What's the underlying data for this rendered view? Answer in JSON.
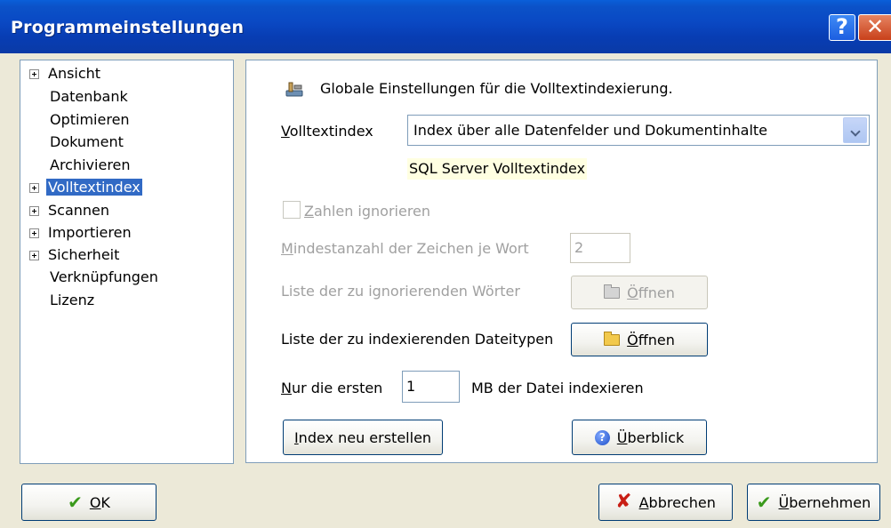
{
  "window": {
    "title": "Programmeinstellungen",
    "help_icon": "help-icon",
    "close_icon": "close-icon"
  },
  "tree": {
    "items": [
      {
        "label": "Ansicht",
        "expandable": true,
        "selected": false
      },
      {
        "label": "Datenbank",
        "expandable": false,
        "selected": false
      },
      {
        "label": "Optimieren",
        "expandable": false,
        "selected": false
      },
      {
        "label": "Dokument",
        "expandable": false,
        "selected": false
      },
      {
        "label": "Archivieren",
        "expandable": false,
        "selected": false
      },
      {
        "label": "Volltextindex",
        "expandable": true,
        "selected": true
      },
      {
        "label": "Scannen",
        "expandable": true,
        "selected": false
      },
      {
        "label": "Importieren",
        "expandable": true,
        "selected": false
      },
      {
        "label": "Sicherheit",
        "expandable": true,
        "selected": false
      },
      {
        "label": "Verknüpfungen",
        "expandable": false,
        "selected": false
      },
      {
        "label": "Lizenz",
        "expandable": false,
        "selected": false
      }
    ]
  },
  "panel": {
    "header": "Globale Einstellungen für die Volltextindexierung.",
    "fulltext_label_u": "V",
    "fulltext_label_rest": "olltextindex",
    "fulltext_value": "Index über alle Datenfelder und Dokumentinhalte",
    "hint": "SQL Server Volltextindex",
    "ignore_numbers_u": "Z",
    "ignore_numbers_rest": "ahlen ignorieren",
    "min_chars_u": "M",
    "min_chars_rest": "indestanzahl der Zeichen je Wort",
    "min_chars_value": "2",
    "ignore_words_label": "Liste der zu ignorierenden Wörter",
    "filetypes_label": "Liste der zu indexierenden Dateitypen",
    "open_u": "Ö",
    "open_rest": "ffnen",
    "first_u": "N",
    "first_rest": "ur die ersten",
    "first_value": "1",
    "mb_label": "MB der Datei indexieren",
    "rebuild_u": "I",
    "rebuild_rest": "ndex neu erstellen",
    "overview_u": "Ü",
    "overview_rest": "berblick"
  },
  "footer": {
    "ok_u": "O",
    "ok_rest": "K",
    "cancel_u": "A",
    "cancel_rest": "bbrechen",
    "apply_u": "Ü",
    "apply_rest": "bernehmen"
  },
  "colors": {
    "title_bar": "#0a49c4",
    "selection": "#316ac5",
    "hint_bg": "#ffffe1",
    "disabled_text": "#a0a0a0"
  }
}
